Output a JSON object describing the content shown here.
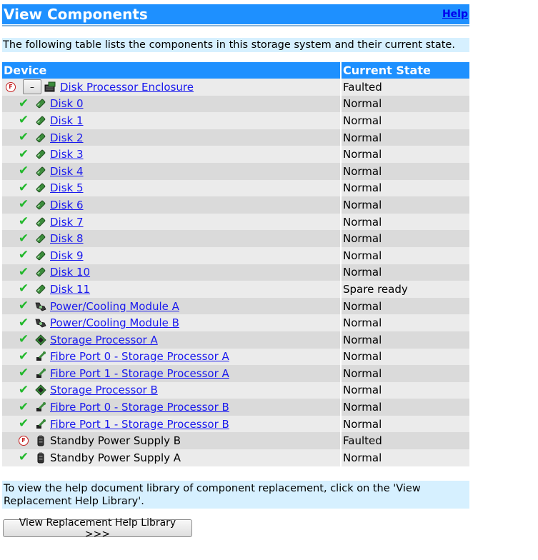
{
  "header": {
    "title": "View Components",
    "help": "Help"
  },
  "intro": "The following table lists the components in this storage system and their current state.",
  "table": {
    "col_device": "Device",
    "col_state": "Current State",
    "rows": [
      {
        "status": "fault",
        "icon": "enclosure-icon",
        "name": "Disk Processor Enclosure",
        "state": "Faulted",
        "link": true,
        "child": false
      },
      {
        "status": "ok",
        "icon": "disk-icon",
        "name": "Disk 0",
        "state": "Normal",
        "link": true,
        "child": true
      },
      {
        "status": "ok",
        "icon": "disk-icon",
        "name": "Disk 1",
        "state": "Normal",
        "link": true,
        "child": true
      },
      {
        "status": "ok",
        "icon": "disk-icon",
        "name": "Disk 2",
        "state": "Normal",
        "link": true,
        "child": true
      },
      {
        "status": "ok",
        "icon": "disk-icon",
        "name": "Disk 3",
        "state": "Normal",
        "link": true,
        "child": true
      },
      {
        "status": "ok",
        "icon": "disk-icon",
        "name": "Disk 4",
        "state": "Normal",
        "link": true,
        "child": true
      },
      {
        "status": "ok",
        "icon": "disk-icon",
        "name": "Disk 5",
        "state": "Normal",
        "link": true,
        "child": true
      },
      {
        "status": "ok",
        "icon": "disk-icon",
        "name": "Disk 6",
        "state": "Normal",
        "link": true,
        "child": true
      },
      {
        "status": "ok",
        "icon": "disk-icon",
        "name": "Disk 7",
        "state": "Normal",
        "link": true,
        "child": true
      },
      {
        "status": "ok",
        "icon": "disk-icon",
        "name": "Disk 8",
        "state": "Normal",
        "link": true,
        "child": true
      },
      {
        "status": "ok",
        "icon": "disk-icon",
        "name": "Disk 9",
        "state": "Normal",
        "link": true,
        "child": true
      },
      {
        "status": "ok",
        "icon": "disk-icon",
        "name": "Disk 10",
        "state": "Normal",
        "link": true,
        "child": true
      },
      {
        "status": "ok",
        "icon": "disk-icon",
        "name": "Disk 11",
        "state": "Spare ready",
        "link": true,
        "child": true
      },
      {
        "status": "ok",
        "icon": "fan-icon",
        "name": "Power/Cooling Module A",
        "state": "Normal",
        "link": true,
        "child": true
      },
      {
        "status": "ok",
        "icon": "fan-icon",
        "name": "Power/Cooling Module B",
        "state": "Normal",
        "link": true,
        "child": true
      },
      {
        "status": "ok",
        "icon": "processor-icon",
        "name": "Storage Processor A",
        "state": "Normal",
        "link": true,
        "child": true
      },
      {
        "status": "ok",
        "icon": "port-icon",
        "name": "Fibre Port 0 - Storage Processor A",
        "state": "Normal",
        "link": true,
        "child": true
      },
      {
        "status": "ok",
        "icon": "port-icon",
        "name": "Fibre Port 1 - Storage Processor A",
        "state": "Normal",
        "link": true,
        "child": true
      },
      {
        "status": "ok",
        "icon": "processor-icon",
        "name": "Storage Processor B",
        "state": "Normal",
        "link": true,
        "child": true
      },
      {
        "status": "ok",
        "icon": "port-icon",
        "name": "Fibre Port 0 - Storage Processor B",
        "state": "Normal",
        "link": true,
        "child": true
      },
      {
        "status": "ok",
        "icon": "port-icon",
        "name": "Fibre Port 1 - Storage Processor B",
        "state": "Normal",
        "link": true,
        "child": true
      },
      {
        "status": "fault",
        "icon": "battery-icon",
        "name": "Standby Power Supply B",
        "state": "Faulted",
        "link": false,
        "child": true
      },
      {
        "status": "ok",
        "icon": "battery-icon",
        "name": "Standby Power Supply A",
        "state": "Normal",
        "link": false,
        "child": true
      }
    ]
  },
  "note": "To view the help document library of component replacement, click on the 'View Replacement Help Library'.",
  "button": "View Replacement Help Library  >>>",
  "colors": {
    "header_bg": "#1e90ff",
    "info_bg": "#d6f0ff",
    "row_light": "#ebebeb",
    "row_dark": "#dadada",
    "ok": "#22b82c",
    "fault": "#c41e1e",
    "link": "#1a1aee"
  }
}
